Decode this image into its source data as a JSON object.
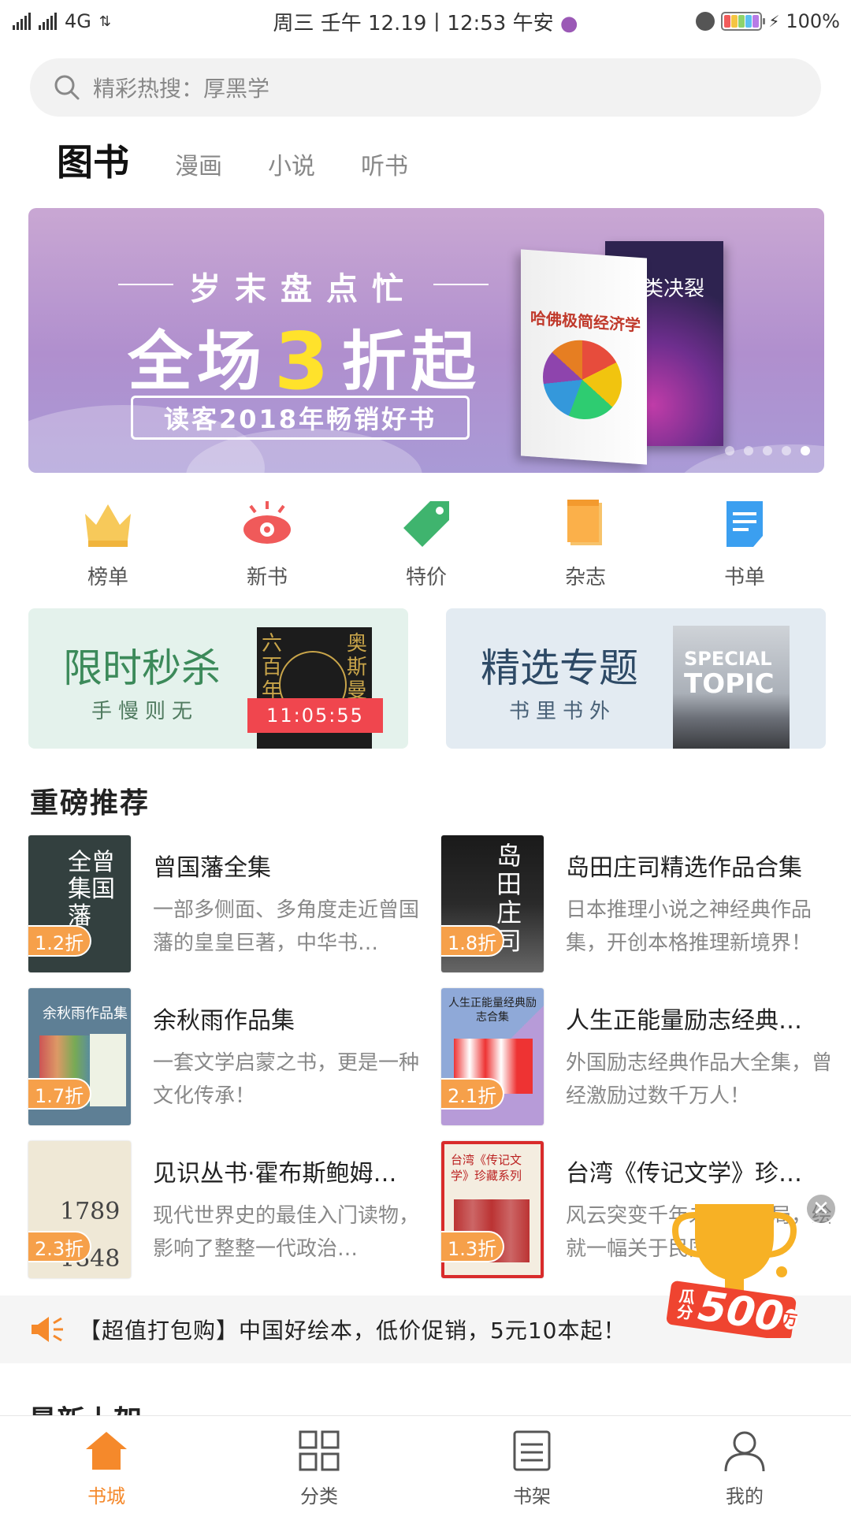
{
  "status_bar": {
    "network": "4G",
    "datetime": "周三  壬午 12.19丨12:53 午安",
    "battery": "100%"
  },
  "search": {
    "placeholder": "精彩热搜：厚黑学"
  },
  "tabs": [
    {
      "label": "图书",
      "active": true
    },
    {
      "label": "漫画",
      "active": false
    },
    {
      "label": "小说",
      "active": false
    },
    {
      "label": "听书",
      "active": false
    }
  ],
  "banner": {
    "line1": "岁末盘点忙",
    "line2_prefix": "全场",
    "line2_num": "3",
    "line2_suffix": "折起",
    "line3": "读客2018年畅销好书",
    "book1_title": "哈佛极简经济学",
    "book2_title": "人类决裂",
    "slides": 5,
    "active_slide": 5
  },
  "categories": [
    {
      "label": "榜单",
      "icon": "crown-icon"
    },
    {
      "label": "新书",
      "icon": "eye-icon"
    },
    {
      "label": "特价",
      "icon": "tag-icon"
    },
    {
      "label": "杂志",
      "icon": "magazine-icon"
    },
    {
      "label": "书单",
      "icon": "booklist-icon"
    }
  ],
  "promo": {
    "flash": {
      "title": "限时秒杀",
      "subtitle": "手慢则无",
      "timer": "11:05:55",
      "cover_left": "六百年",
      "cover_right": "奥斯曼帝"
    },
    "topic": {
      "title": "精选专题",
      "subtitle": "书里书外",
      "cover_line1": "SPECIAL",
      "cover_line2": "TOPIC"
    }
  },
  "section_title": "重磅推荐",
  "recommendations": [
    {
      "title": "曾国藩全集",
      "desc": "一部多侧面、多角度走近曾国藩的皇皇巨著，中华书…",
      "discount": "1.2折",
      "cover_text": "全曾集国藩",
      "cover_color": "#33403f"
    },
    {
      "title": "岛田庄司精选作品合集",
      "desc": "日本推理小说之神经典作品集，开创本格推理新境界！",
      "discount": "1.8折",
      "cover_text": "岛田庄司",
      "cover_color": "#1a1a1a"
    },
    {
      "title": "余秋雨作品集",
      "desc": "一套文学启蒙之书，更是一种文化传承！",
      "discount": "1.7折",
      "cover_text": "余秋雨作品集",
      "cover_color": "#5e7f95"
    },
    {
      "title": "人生正能量励志经典…",
      "desc": "外国励志经典作品大全集，曾经激励过数千万人！",
      "discount": "2.1折",
      "cover_text": "人生正能量经典励志合集",
      "cover_color": "#8fa9d8"
    },
    {
      "title": "见识丛书·霍布斯鲍姆…",
      "desc": "现代世界史的最佳入门读物，影响了整整一代政治…",
      "discount": "2.3折",
      "cover_text": "1789 1848",
      "cover_color": "#efe8d6"
    },
    {
      "title": "台湾《传记文学》珍…",
      "desc": "风云突变千年未有之变局，绘就一幅关于民国人物…",
      "discount": "1.3折",
      "cover_text": "台湾《传记文学》珍藏系列",
      "cover_color": "#f4ede0"
    }
  ],
  "notice": {
    "text": "【超值打包购】中国好绘本，低价促销，5元10本起！",
    "icon": "megaphone-icon"
  },
  "next_section_title": "最新上架",
  "prize_badge": {
    "top_text": "瓜分",
    "amount": "500",
    "unit": "万"
  },
  "bottom_nav": [
    {
      "label": "书城",
      "icon": "home-icon",
      "active": true
    },
    {
      "label": "分类",
      "icon": "grid-icon",
      "active": false
    },
    {
      "label": "书架",
      "icon": "shelf-icon",
      "active": false
    },
    {
      "label": "我的",
      "icon": "user-icon",
      "active": false
    }
  ],
  "colors": {
    "accent": "#f5892b",
    "discount": "#f6a04a",
    "timer": "#f0464e"
  }
}
